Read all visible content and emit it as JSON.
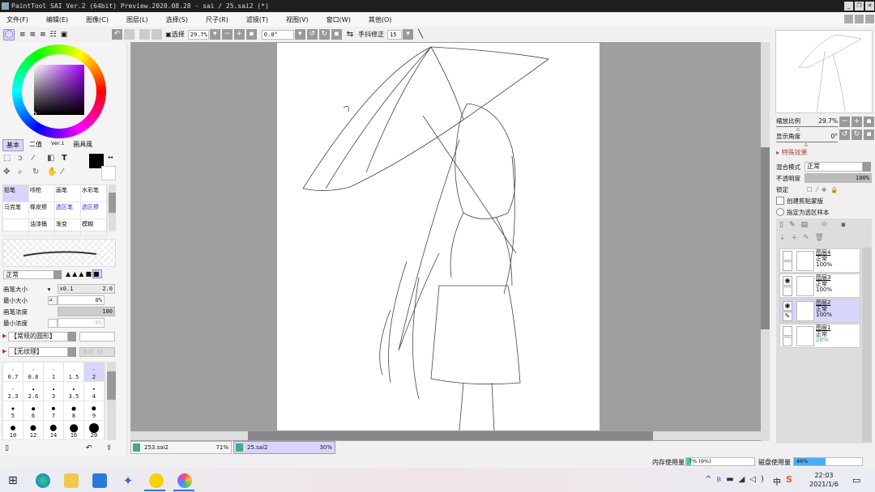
{
  "title": "PaintTool SAI Ver.2 (64bit) Preview.2020.08.28 - sai / 25.sai2 (*)",
  "menu": [
    "文件(F)",
    "编辑(E)",
    "图像(C)",
    "图层(L)",
    "选择(S)",
    "尺子(R)",
    "滤镜(T)",
    "视图(V)",
    "窗口(W)",
    "其他(O)"
  ],
  "toolbar": {
    "select_label": "选择",
    "zoom": "29.7%",
    "angle": "0.0°",
    "stabilizer_label": "手抖修正",
    "stabilizer": "15"
  },
  "left": {
    "tabs": [
      "基本",
      "二值",
      "Ver.1",
      "画具風"
    ],
    "brushes": [
      [
        "铅笔",
        "喷枪",
        "画笔",
        "水彩笔"
      ],
      [
        "马克笔",
        "橡皮擦",
        "选区笔",
        "选区擦"
      ],
      [
        "",
        "油漆桶",
        "渐变",
        "模糊"
      ]
    ],
    "blend_mode": "正常",
    "brush_size_label": "画笔大小",
    "brush_size_mult": "x0.1",
    "brush_size": "2.0",
    "min_size_label": "最小大小",
    "min_size": "0%",
    "density_label": "画笔浓度",
    "density": "100",
    "min_density_label": "最小浓度",
    "min_density": "0%",
    "shape": "【常规的圆形】",
    "texture": "【无纹理】",
    "texture_amount": "强度 95",
    "sizes": [
      "0.7",
      "0.8",
      "1",
      "1.5",
      "2",
      "2.3",
      "2.6",
      "3",
      "3.5",
      "4",
      "5",
      "6",
      "7",
      "8",
      "9",
      "10",
      "12",
      "14",
      "16",
      "20"
    ]
  },
  "navigator": {
    "zoom_label": "缩放比例",
    "zoom": "29.7%",
    "angle_label": "显示角度",
    "angle": "0°"
  },
  "layer_props": {
    "effects_label": "特殊效果",
    "blend_label": "混合模式",
    "blend": "正常",
    "opacity_label": "不透明度",
    "opacity": "100%",
    "lock_label": "锁定",
    "clip_label": "创建剪贴蒙版",
    "sample_label": "指定为选区样本"
  },
  "layers": [
    {
      "name": "图层4",
      "mode": "正常",
      "opacity": "100%",
      "visible": false,
      "selected": false
    },
    {
      "name": "图层3",
      "mode": "正常",
      "opacity": "100%",
      "visible": true,
      "selected": false
    },
    {
      "name": "图层2",
      "mode": "正常",
      "opacity": "100%",
      "visible": true,
      "selected": true
    },
    {
      "name": "图层1",
      "mode": "正常",
      "opacity": "20%",
      "visible": false,
      "selected": false
    }
  ],
  "docs": [
    {
      "name": "253.sai2",
      "zoom": "71%"
    },
    {
      "name": "25.sai2",
      "zoom": "30%"
    }
  ],
  "status": {
    "mem_label": "内存使用量",
    "mem": "7% (9%)",
    "disk_label": "磁盘使用量",
    "disk": "46%",
    "mem_fraction": 0.07,
    "disk_fraction": 0.46
  },
  "taskbar": {
    "time": "22:03",
    "date": "2021/1/6",
    "ime": "中"
  },
  "colors": {
    "selection": "#d6d6fb",
    "canvas_bg": "#9f9f9f",
    "accent": "#3a6df0"
  }
}
